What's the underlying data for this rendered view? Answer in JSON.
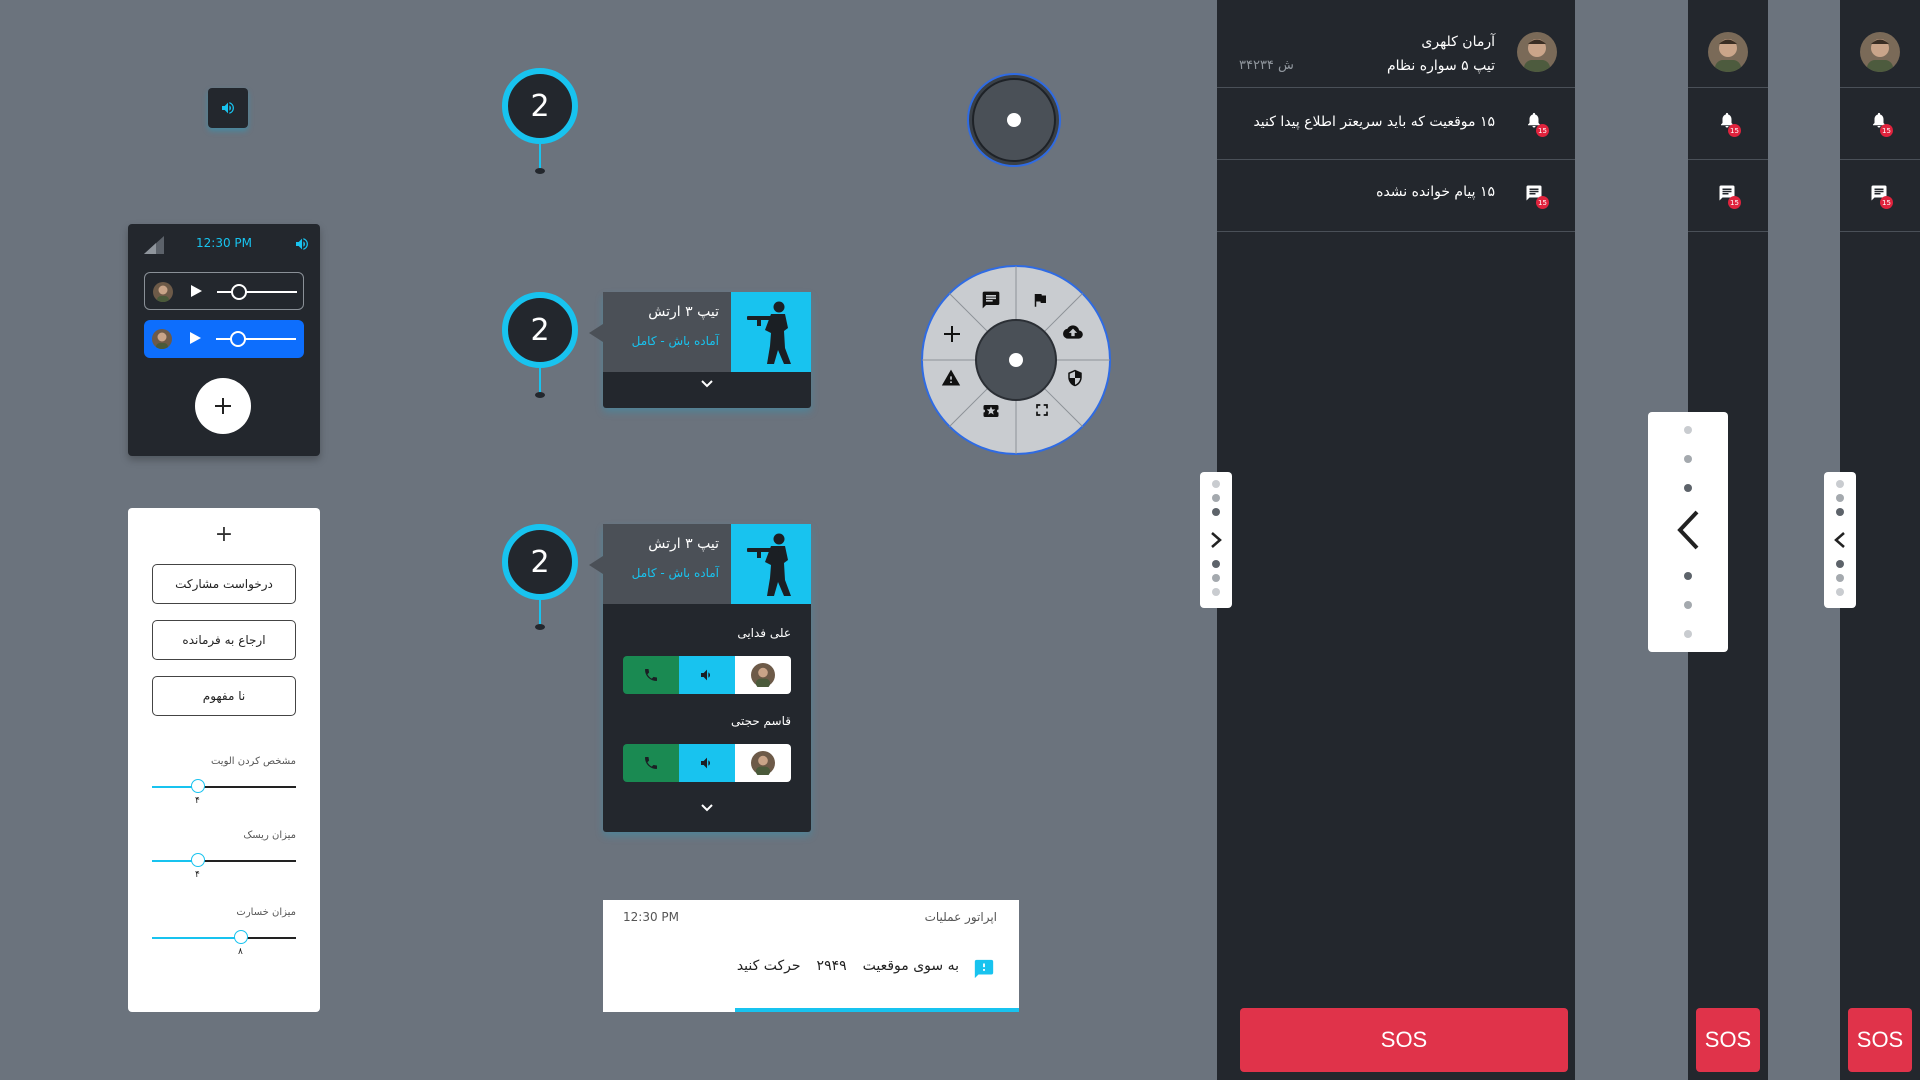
{
  "colors": {
    "accent": "#18c3ef",
    "panel": "#23272d",
    "sos": "#e0334a",
    "call_green": "#1a8a52",
    "active_blue": "#0d6efd",
    "background": "#6b737d"
  },
  "voice_panel": {
    "time": "12:30 PM"
  },
  "actions_panel": {
    "plus": "+",
    "buttons": [
      "درخواست مشارکت",
      "ارجاع به فرمانده",
      "نا مفهوم"
    ],
    "sliders": [
      {
        "label": "مشخص کردن الویت",
        "value": "۴",
        "fraction": 0.32
      },
      {
        "label": "میزان ریسک",
        "value": "۴",
        "fraction": 0.32
      },
      {
        "label": "میزان خسارت",
        "value": "۸",
        "fraction": 0.62
      }
    ]
  },
  "pins": [
    {
      "label": "2"
    },
    {
      "label": "2"
    },
    {
      "label": "2"
    }
  ],
  "team_card": {
    "title": "تیپ ۳ ارتش",
    "status": "آماده باش - کامل"
  },
  "members": [
    {
      "name": "علی فدایی"
    },
    {
      "name": "قاسم حجتی"
    }
  ],
  "radial_menu": {
    "icons": [
      "message-icon",
      "flag-icon",
      "cloud-upload-icon",
      "shield-icon",
      "fullscreen-icon",
      "ticket-icon",
      "warning-icon",
      "plus-icon"
    ]
  },
  "notification": {
    "source": "اپراتور عملیات",
    "time": "12:30 PM",
    "action": "به سوی موقعیت",
    "number": "۲۹۴۹",
    "action2": "حرکت کنید"
  },
  "sidebar": {
    "user_name": "آرمان کلهری",
    "unit": "تیپ ۵ سواره نظام",
    "id": "ش ۳۴۲۳۴",
    "alerts": "۱۵ موقعیت که باید سریعتر اطلاع پیدا کنید",
    "messages": "۱۵ پیام خوانده نشده",
    "badge": "15",
    "sos": "SOS"
  }
}
